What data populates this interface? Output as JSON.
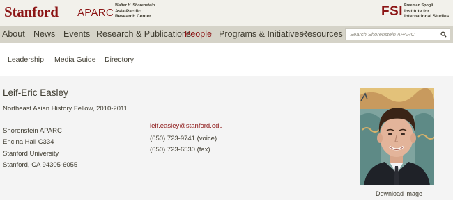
{
  "header": {
    "stanford": "Stanford",
    "aparc": "APARC",
    "aparc_sub_1": "Walter H. Shorenstein",
    "aparc_sub_2": "Asia-Pacific",
    "aparc_sub_3": "Research Center",
    "fsi": "FSI",
    "fsi_sub_1": "Freeman Spogli",
    "fsi_sub_2": "Institute for",
    "fsi_sub_3": "International Studies"
  },
  "nav": {
    "items": [
      "About",
      "News",
      "Events",
      "Research & Publications",
      "People",
      "Programs & Initiatives",
      "Resources"
    ],
    "active": "People"
  },
  "search": {
    "placeholder": "Search Shorenstein APARC"
  },
  "subnav": {
    "items": [
      "Leadership",
      "Media Guide",
      "Directory"
    ]
  },
  "profile": {
    "name": "Leif-Eric Easley",
    "role": "Northeast Asian History Fellow, 2010-2011",
    "address": [
      "Shorenstein APARC",
      "Encina Hall C334",
      "Stanford University",
      "Stanford, CA 94305-6055"
    ],
    "email": "leif.easley@stanford.edu",
    "phones": [
      "(650) 723-9741 (voice)",
      "(650) 723-6530 (fax)"
    ],
    "download_label": "Download image"
  },
  "colors": {
    "cardinal": "#8c1515",
    "nav_bg": "#d5d3c8",
    "header_bg": "#f2f1eb",
    "text": "#3f3c30"
  }
}
